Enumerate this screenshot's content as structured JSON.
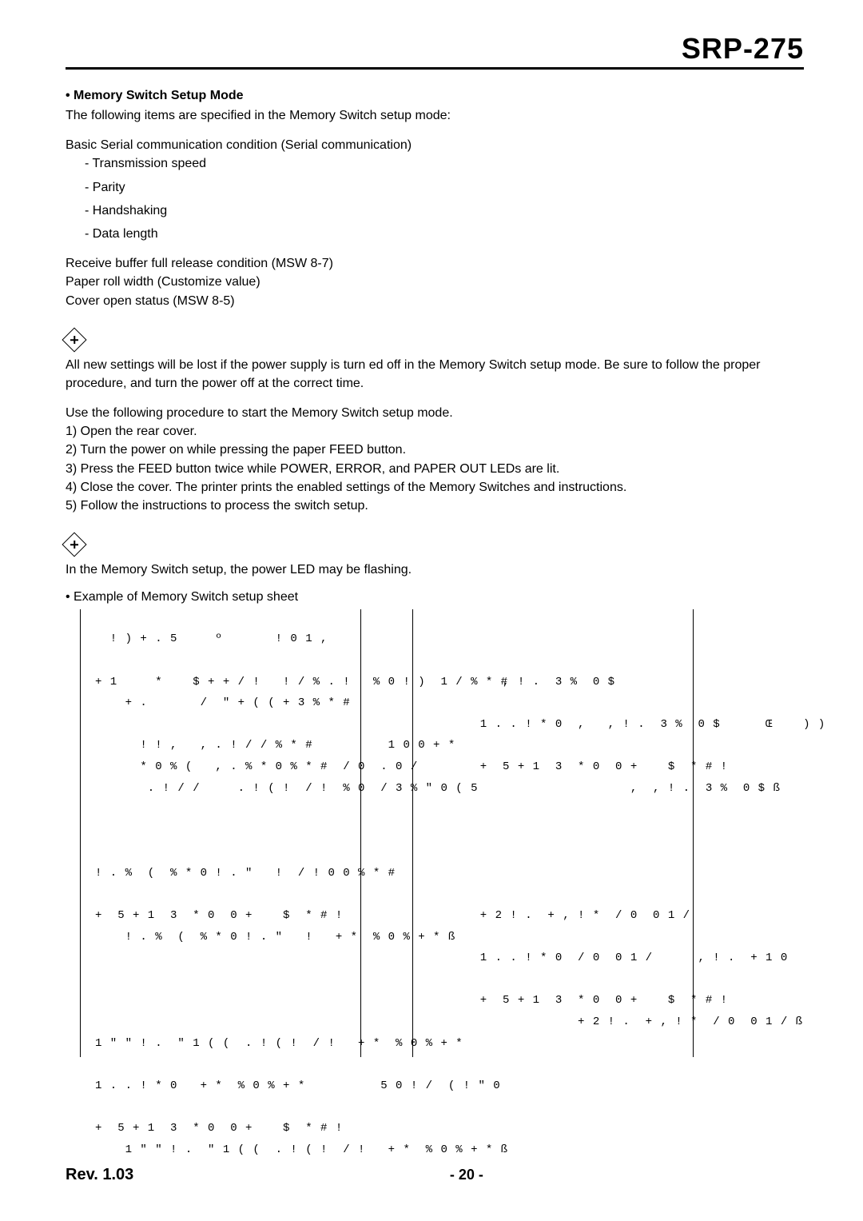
{
  "header": {
    "model": "SRP-275"
  },
  "section": {
    "title": "• Memory Switch Setup Mode",
    "intro": "The following items are specified in the Memory Switch setup mode:",
    "serial_intro": "Basic Serial communication condition (Serial communication)",
    "serial_items": {
      "a": "- Transmission speed",
      "b": "- Parity",
      "c": "- Handshaking",
      "d": "- Data length"
    },
    "other": {
      "a": "Receive buffer full release condition (MSW 8-7)",
      "b": "Paper roll width (Customize value)",
      "c": "Cover open status (MSW 8-5)"
    }
  },
  "note1": "All new settings will be lost if the power supply is turn          ed off in the Memory Switch setup mode. Be sure to follow the proper procedure, and turn the power off at the correct time.",
  "procedure": {
    "intro": "Use the following procedure to start the Memory Switch setup mode.",
    "s1": "1) Open the rear cover.",
    "s2": "2) Turn the power on while pressing the paper FEED button.",
    "s3": "3) Press the FEED button twice while POWER, ERROR, and PAPER OUT LEDs are lit.",
    "s4": "4) Close the cover. The printer prints the enabled settings of the Memory Switches and instructions.",
    "s5": "5) Follow the instructions to process the switch setup."
  },
  "note2": "In the Memory Switch setup, the power LED may be flashing.",
  "example_title": "• Example of Memory Switch setup sheet",
  "sheets": {
    "left": "  ! ) + . 5     º       ! 0 1 ,\n\n+ 1     *    $ + + / !   ! / % . !   % 0 ! )  1 / % * #\n    + .       /  \" + ( ( + 3 % * #\n\n      ! ! ,   , . ! / / % * #          1 0 0 + *\n      * 0 % (   , . % * 0 % * #  / 0  . 0 /\n       . ! / /     . ! ( !  / !  % 0  / 3 % \" 0 ( 5\n\n\n\n! . %  (  % * 0 ! . \"   !  / ! 0 0 % * #\n\n+  5 + 1  3  * 0  0 +    $  * # !\n    ! . %  (  % * 0 ! . \"   !   + *  % 0 % + * ß\n\n\n\n\n1 \" \" ! .  \" 1 ( (  . ! ( !  / !   + *  % 0 % + *\n\n1 . . ! * 0   + *  % 0 % + *          5 0 ! /  ( ! \" 0\n\n+  5 + 1  3  * 0  0 +    $  * # !\n    1 \" \" ! .  \" 1 ( (  . ! ( !  / !   + *  % 0 % + * ß",
    "right": "\n\n          , ! .  3 %  0 $\n\n       1 . . ! * 0  ,   , ! .  3 %  0 $      Œ    ) )\n\n       +  5 + 1  3  * 0  0 +    $  * # !\n                           ,  , ! .  3 %  0 $ ß\n\n\n\n\n\n       + 2 ! .  + , ! *  / 0  0 1 /\n\n       1 . . ! * 0  / 0  0 1 /      , ! .  + 1 0\n\n       +  5 + 1  3  * 0  0 +    $  * # !\n                    + 2 ! .  + , ! *  / 0  0 1 / ß"
  },
  "footer": {
    "rev": "Rev. 1.03",
    "page": "- 20 -"
  }
}
